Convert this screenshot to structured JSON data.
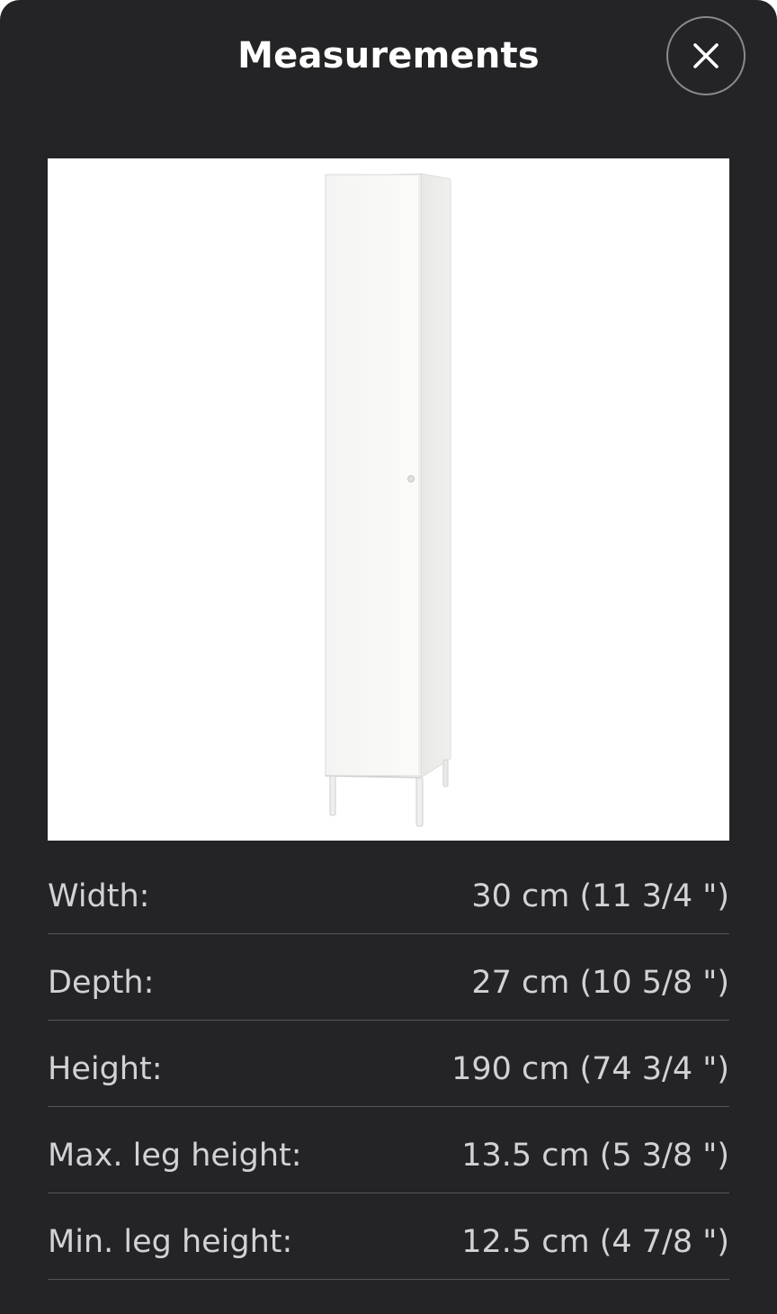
{
  "header": {
    "title": "Measurements",
    "close_icon": "close-icon"
  },
  "product_image": {
    "subject": "tall white cabinet on legs",
    "icon": "cabinet-image"
  },
  "measurements": [
    {
      "label": "Width:",
      "value": "30 cm (11 3/4 \")"
    },
    {
      "label": "Depth:",
      "value": "27 cm (10 5/8 \")"
    },
    {
      "label": "Height:",
      "value": "190 cm (74 3/4 \")"
    },
    {
      "label": "Max. leg height:",
      "value": "13.5 cm (5 3/8 \")"
    },
    {
      "label": "Min. leg height:",
      "value": "12.5 cm (4 7/8 \")"
    }
  ],
  "colors": {
    "sheet_background": "#242426",
    "text_primary": "#ffffff",
    "text_secondary": "#d2d2d4",
    "divider": "#545457",
    "close_border": "#8a8a8d"
  }
}
